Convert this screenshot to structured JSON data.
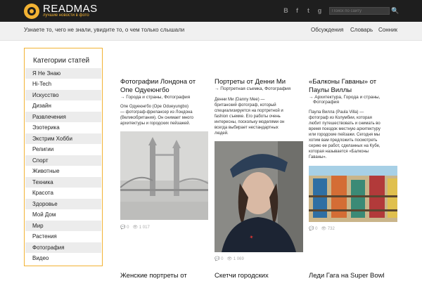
{
  "header": {
    "title": "READMAS",
    "tagline": "лучшие новости в фото",
    "social": [
      "B",
      "f",
      "t",
      "g"
    ],
    "search_placeholder": "Поиск по сайту",
    "search_button": "🔍"
  },
  "subheader": {
    "tagline": "Узнаете то, чего не знали, увидите то, о чем только слышали",
    "nav": [
      "Обсуждения",
      "Словарь",
      "Сонник"
    ]
  },
  "sidebar": {
    "title": "Категории статей",
    "items": [
      "Я Не Знаю",
      "Hi-Tech",
      "Искусство",
      "Дизайн",
      "Развлечения",
      "Эзотерика",
      "Экстрим Хобби",
      "Религии",
      "Спорт",
      "Животные",
      "Техника",
      "Красота",
      "Здоровье",
      "Мой Дом",
      "Мир",
      "Растения",
      "Фотография",
      "Видео"
    ]
  },
  "articles": [
    {
      "title_1": "Фотографии Лондона от",
      "title_2": "Опе Одуеюнгбо",
      "cat_1": "→ Города и страны, Фотография",
      "text_1": "Опе Одуеюнгбо (Ope Odueyungbo)",
      "text_2": "— фотограф-фрилансер из Лондона",
      "text_3": "(Великобритания). Он снимает много",
      "text_4": "архитектуры и городских пейзажей.",
      "comments": "0",
      "views": "1 017"
    },
    {
      "title_1": "Портреты от Денни Ми",
      "cat_1": "→ Портретная съемка, Фотография",
      "text_1": "Денни Ми (Danny Mee) —",
      "text_2": "британский фотограф, который",
      "text_3": "специализируется на портретной и",
      "text_4": "fashion съемке. Его работы очень",
      "text_5": "интересны, поскольку моделями он",
      "text_6": "всегда выбирает нестандартных",
      "text_7": "людей.",
      "comments": "0",
      "views": "1 069"
    },
    {
      "title_1": "«Балконы Гаваны» от",
      "title_2": "Паулы Виллы",
      "cat_1": "→ Архитектура, Города и страны,",
      "cat_2": "Фотография",
      "text_1": "Паула Вилла (Paula Villa) —",
      "text_2": "фотограф из Колумбии, которая",
      "text_3": "любит путешествовать и снимать во",
      "text_4": "время поездок местную архитектуру",
      "text_5": "или городские пейзажи. Сегодня мы",
      "text_6": "хотим вам предложить посмотреть",
      "text_7": "серию ее работ, сделанных на Кубе,",
      "text_8": "которая называется «Балконы",
      "text_9": "Гаваны».",
      "comments": "0",
      "views": "732"
    }
  ],
  "bottom_titles": [
    "Женские портреты от",
    "Скетчи городских",
    "Леди Гага на Super Bowl"
  ],
  "colors": {
    "accent": "#f2b233",
    "topbar": "#1e1e1e",
    "subbar": "#f0f0f0"
  }
}
